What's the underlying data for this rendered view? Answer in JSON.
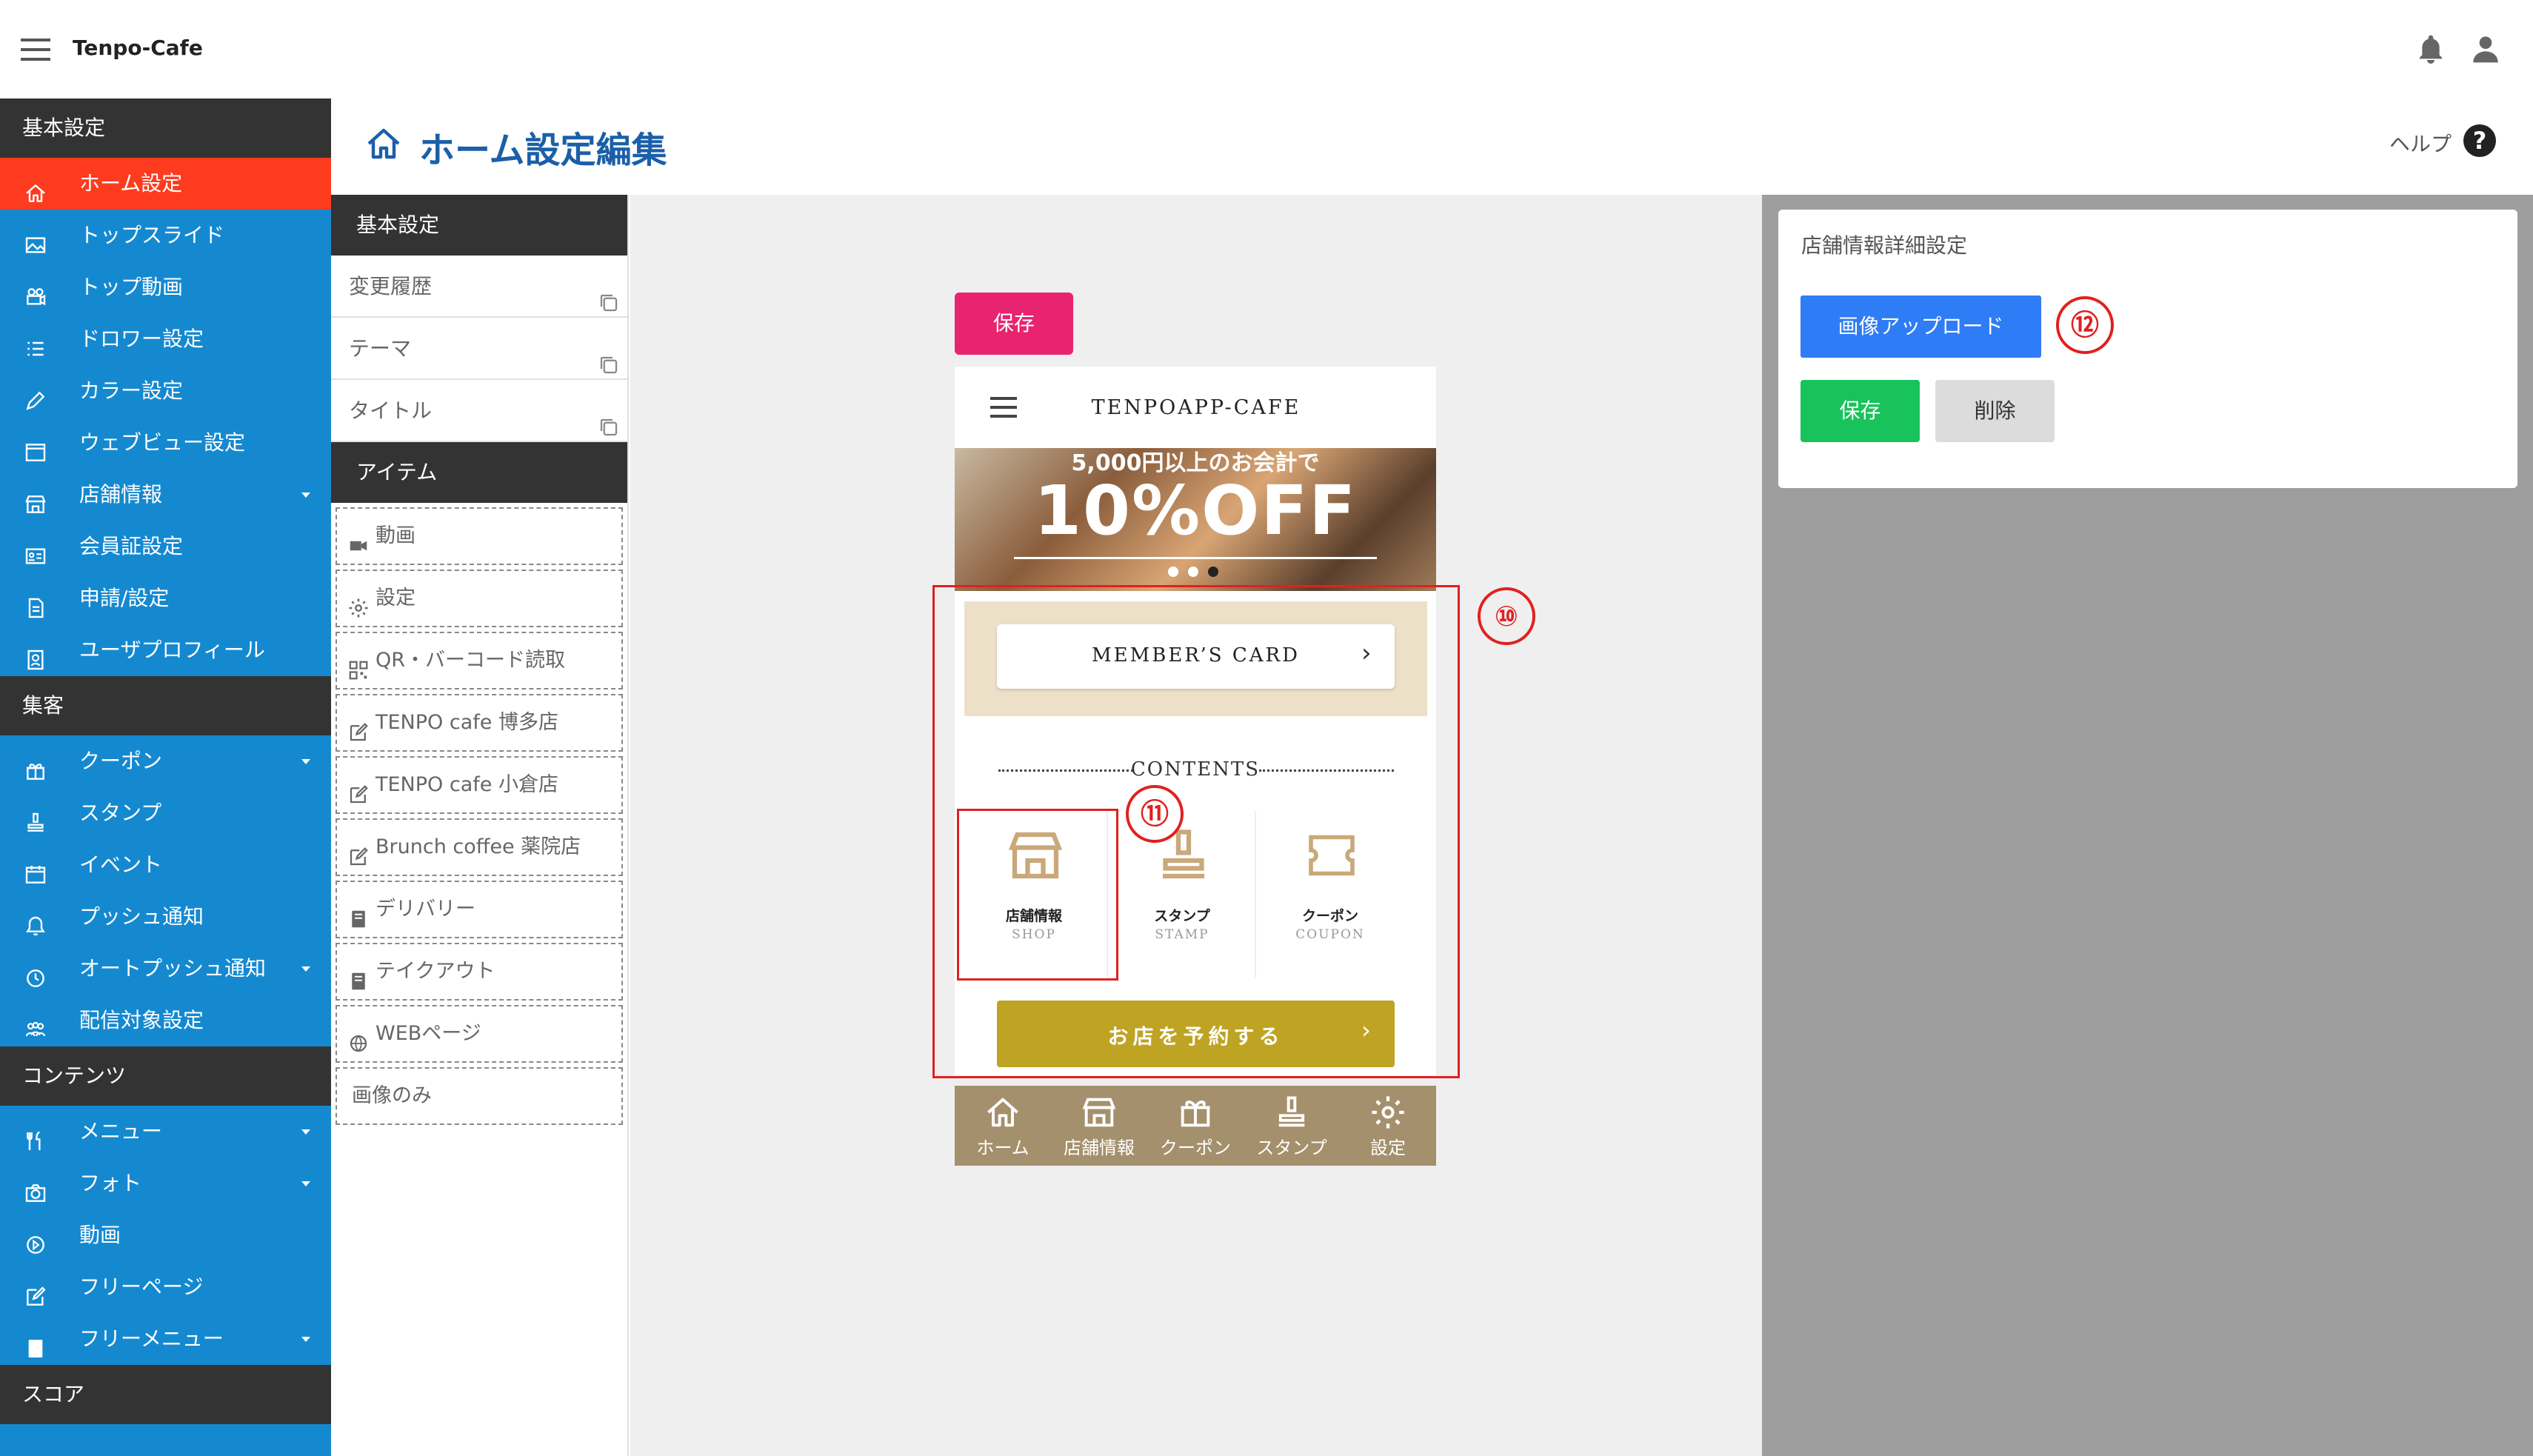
{
  "app": {
    "title": "Tenpo-Cafe"
  },
  "sidebar": {
    "sections": [
      {
        "label": "基本設定",
        "items": [
          {
            "label": "ホーム設定",
            "icon": "home-icon",
            "active": true,
            "caret": false
          },
          {
            "label": "トップスライド",
            "icon": "image-icon",
            "caret": false
          },
          {
            "label": "トップ動画",
            "icon": "video-camera-icon",
            "caret": false
          },
          {
            "label": "ドロワー設定",
            "icon": "list-icon",
            "caret": false
          },
          {
            "label": "カラー設定",
            "icon": "pen-icon",
            "caret": false
          },
          {
            "label": "ウェブビュー設定",
            "icon": "browser-icon",
            "caret": false
          },
          {
            "label": "店舗情報",
            "icon": "store-icon",
            "caret": true
          },
          {
            "label": "会員証設定",
            "icon": "id-card-icon",
            "caret": false
          },
          {
            "label": "申請/設定",
            "icon": "document-icon",
            "caret": false
          },
          {
            "label": "ユーザプロフィール",
            "icon": "profile-icon",
            "caret": false
          }
        ]
      },
      {
        "label": "集客",
        "items": [
          {
            "label": "クーポン",
            "icon": "gift-icon",
            "caret": true
          },
          {
            "label": "スタンプ",
            "icon": "stamp-icon",
            "caret": false
          },
          {
            "label": "イベント",
            "icon": "calendar-icon",
            "caret": false
          },
          {
            "label": "プッシュ通知",
            "icon": "bell-icon",
            "caret": false
          },
          {
            "label": "オートプッシュ通知",
            "icon": "clock-icon",
            "caret": true
          },
          {
            "label": "配信対象設定",
            "icon": "users-icon",
            "caret": false
          }
        ]
      },
      {
        "label": "コンテンツ",
        "items": [
          {
            "label": "メニュー",
            "icon": "utensils-icon",
            "caret": true
          },
          {
            "label": "フォト",
            "icon": "camera-icon",
            "caret": true
          },
          {
            "label": "動画",
            "icon": "play-icon",
            "caret": false
          },
          {
            "label": "フリーページ",
            "icon": "edit-icon",
            "caret": false
          },
          {
            "label": "フリーメニュー",
            "icon": "book-icon",
            "caret": true
          }
        ]
      },
      {
        "label": "スコア",
        "items": []
      }
    ]
  },
  "header": {
    "title": "ホーム設定編集",
    "help_label": "ヘルプ",
    "help_icon": "?"
  },
  "settings_panel": {
    "basic_header": "基本設定",
    "basic_rows": [
      {
        "label": "変更履歴"
      },
      {
        "label": "テーマ"
      },
      {
        "label": "タイトル"
      }
    ],
    "items_header": "アイテム",
    "items": [
      {
        "label": "動画",
        "icon": "video-icon"
      },
      {
        "label": "設定",
        "icon": "gear-icon"
      },
      {
        "label": "QR・バーコード読取",
        "icon": "qr-icon"
      },
      {
        "label": "TENPO cafe 博多店",
        "icon": "edit-icon"
      },
      {
        "label": "TENPO cafe 小倉店",
        "icon": "edit-icon"
      },
      {
        "label": "Brunch coffee 薬院店",
        "icon": "edit-icon"
      },
      {
        "label": "デリバリー",
        "icon": "book-icon"
      },
      {
        "label": "テイクアウト",
        "icon": "book-icon"
      },
      {
        "label": "WEBページ",
        "icon": "globe-icon"
      },
      {
        "label": "画像のみ",
        "icon": ""
      }
    ]
  },
  "preview": {
    "save_label": "保存",
    "phone_title": "TENPOAPP-CAFE",
    "slide_text_small": "5,000円以上のお会計で",
    "slide_text_big": "10%OFF",
    "slide_dots": {
      "count": 3,
      "active_index": 2
    },
    "member_card_label": "MEMBER’S CARD",
    "contents_label": "CONTENTS",
    "tiles": [
      {
        "name": "店舗情報",
        "sub": "SHOP",
        "icon": "store-icon"
      },
      {
        "name": "スタンプ",
        "sub": "STAMP",
        "icon": "stamp-icon"
      },
      {
        "name": "クーポン",
        "sub": "COUPON",
        "icon": "ticket-icon"
      }
    ],
    "reserve_label": "お店を予約する",
    "tabbar": [
      {
        "label": "ホーム",
        "icon": "home-icon"
      },
      {
        "label": "店舗情報",
        "icon": "store-icon"
      },
      {
        "label": "クーポン",
        "icon": "gift-icon"
      },
      {
        "label": "スタンプ",
        "icon": "stamp-icon"
      },
      {
        "label": "設定",
        "icon": "gear-icon"
      }
    ]
  },
  "annotations": {
    "marker_10": "⑩",
    "marker_11": "⑪",
    "marker_12": "⑫"
  },
  "detail_panel": {
    "title": "店舗情報詳細設定",
    "upload_label": "画像アップロード",
    "save_label": "保存",
    "delete_label": "削除"
  },
  "colors": {
    "sidebar": "#1589d0",
    "sidebar_active": "#ff3b1f",
    "section_header": "#333333",
    "save_pink": "#e8236f",
    "reserve_gold": "#bfa323",
    "tabbar": "#a5906d",
    "upload_blue": "#2e7cf6",
    "save_green": "#17c35a",
    "annotation_red": "#e12020"
  }
}
